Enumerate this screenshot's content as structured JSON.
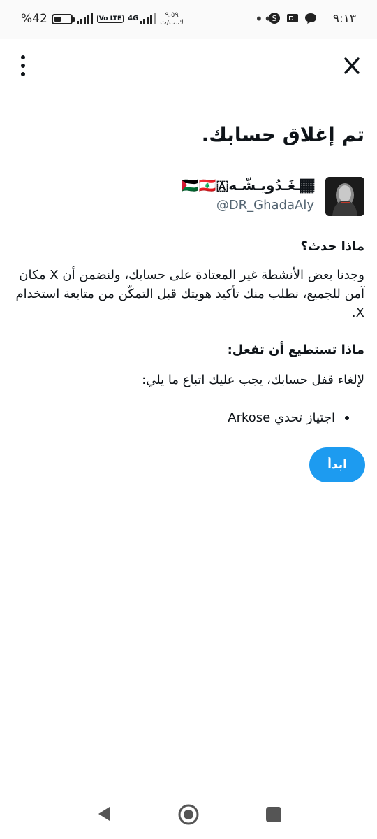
{
  "status_bar": {
    "time": "٩:١٣",
    "battery_percent": "%42",
    "network_small_top": "٩،٥٩",
    "network_small_bottom": "ك.ب/ث",
    "network_type": "4G",
    "volte": "Vo LTE",
    "dots": "•••",
    "battery_level": 0.42
  },
  "top_bar": {
    "close_icon": "x-close-icon",
    "menu_icon": "kebab-menu-icon"
  },
  "page": {
    "title": "تم إغلاق حسابك.",
    "account": {
      "display_name": "🏾ـغَـدُويـشّـه🇵🇸🇱🇧🇦",
      "handle": "@DR_GhadaAly"
    },
    "what_happened_heading": "ماذا حدث؟",
    "what_happened_text": "وجدنا بعض الأنشطة غير المعتادة على حسابك، ولنضمن أن X مكان آمن للجميع، نطلب منك تأكيد هويتك قبل التمكّن من متابعة استخدام X.",
    "what_to_do_heading": "ماذا تستطيع أن تفعل:",
    "what_to_do_text": "لإلغاء قفل حسابك، يجب عليك اتباع ما يلي:",
    "steps": [
      "اجتياز تحدي Arkose"
    ],
    "start_button": "ابدأ"
  },
  "colors": {
    "accent": "#1d9bf0",
    "text": "#0f1419",
    "secondary_text": "#536471"
  }
}
